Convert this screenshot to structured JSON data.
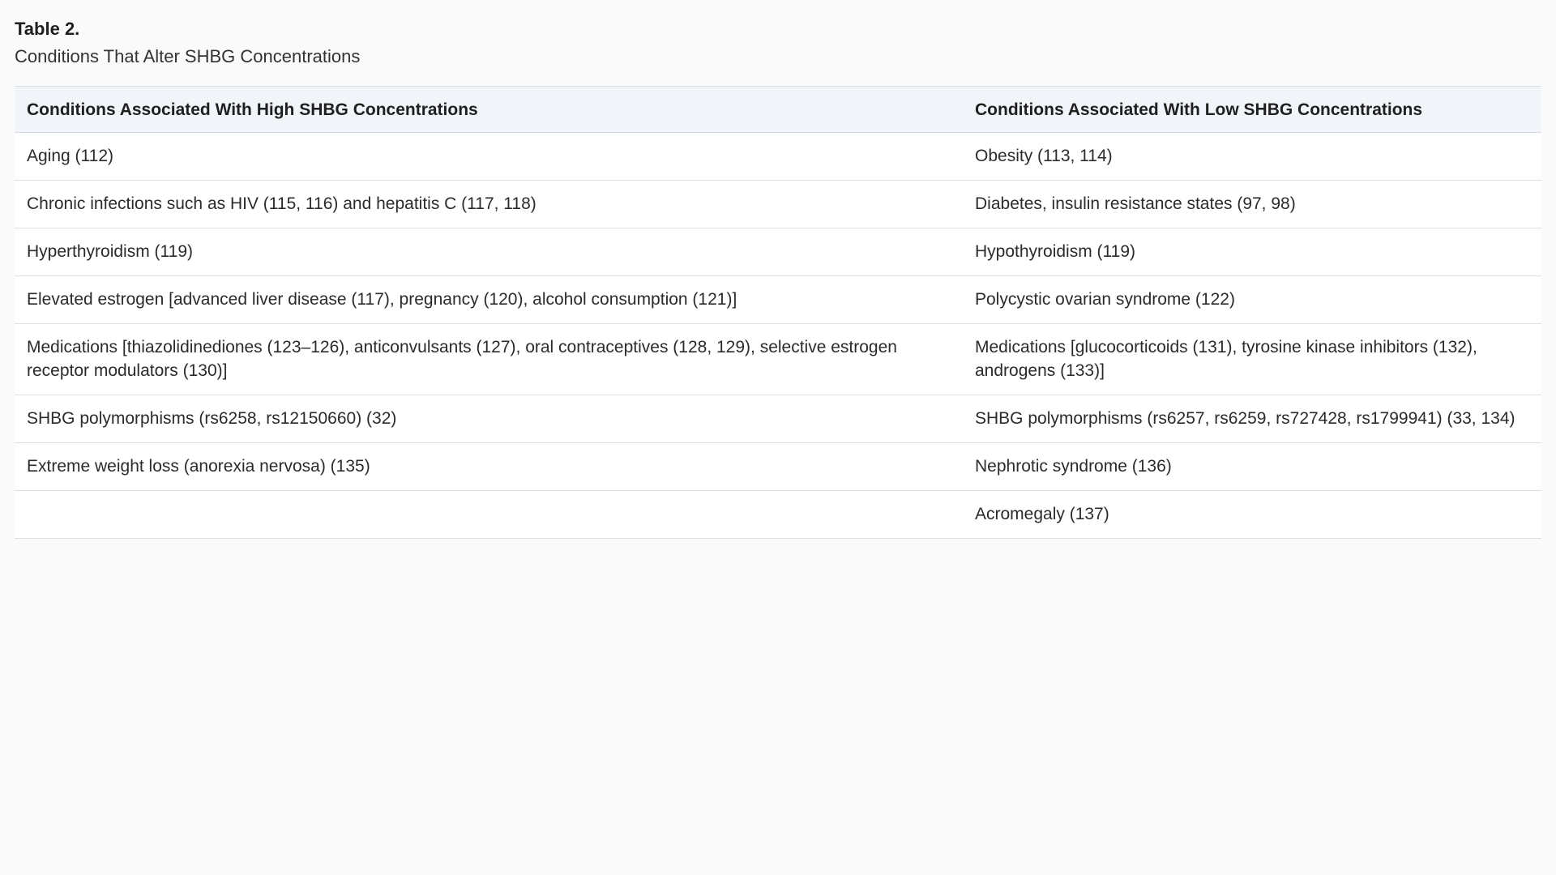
{
  "table": {
    "label": "Table 2.",
    "caption": "Conditions That Alter SHBG Concentrations",
    "headers": [
      "Conditions Associated With High SHBG Concentrations",
      "Conditions Associated With Low SHBG Concentrations"
    ],
    "rows": [
      [
        "Aging (112)",
        "Obesity (113, 114)"
      ],
      [
        "Chronic infections such as HIV (115, 116) and hepatitis C (117, 118)",
        "Diabetes, insulin resistance states (97, 98)"
      ],
      [
        "Hyperthyroidism (119)",
        "Hypothyroidism (119)"
      ],
      [
        "Elevated estrogen [advanced liver disease (117), pregnancy (120), alcohol consumption (121)]",
        "Polycystic ovarian syndrome (122)"
      ],
      [
        "Medications [thiazolidinediones (123–126), anticonvulsants (127), oral contraceptives (128, 129), selective estrogen receptor modulators (130)]",
        "Medications [glucocorticoids (131), tyrosine kinase inhibitors (132), androgens (133)]"
      ],
      [
        "SHBG polymorphisms (rs6258, rs12150660) (32)",
        "SHBG polymorphisms (rs6257, rs6259, rs727428, rs1799941) (33, 134)"
      ],
      [
        "Extreme weight loss (anorexia nervosa) (135)",
        "Nephrotic syndrome (136)"
      ],
      [
        "",
        "Acromegaly (137)"
      ]
    ]
  }
}
